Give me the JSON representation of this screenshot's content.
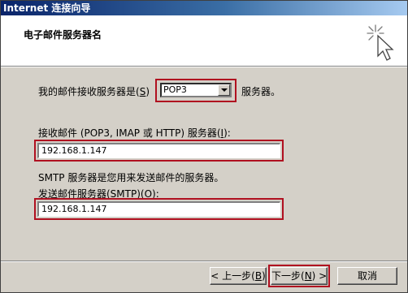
{
  "window": {
    "title": "Internet 连接向导"
  },
  "header": {
    "title": "电子邮件服务器名",
    "icon": "wizard-sparkle-cursor-icon"
  },
  "incoming_type": {
    "label_prefix": "我的邮件接收服务器是",
    "label_key": "S",
    "selected": "POP3",
    "suffix": "服务器。"
  },
  "incoming_server": {
    "label_prefix": "接收邮件 (POP3, IMAP 或 HTTP) 服务器",
    "label_key": "I",
    "value": "192.168.1.147"
  },
  "smtp_note": "SMTP 服务器是您用来发送邮件的服务器。",
  "outgoing_server": {
    "label_prefix": "发送邮件服务器(SMTP)",
    "label_key": "O",
    "value": "192.168.1.147"
  },
  "buttons": {
    "back": {
      "pre": "< 上一步(",
      "key": "B",
      "post": ")"
    },
    "next": {
      "pre": "下一步(",
      "key": "N",
      "post": ") >"
    },
    "cancel": "取消"
  },
  "colors": {
    "highlight": "#b01020",
    "title_bar": "#0a246a",
    "dialog_face": "#d4d0c8"
  }
}
